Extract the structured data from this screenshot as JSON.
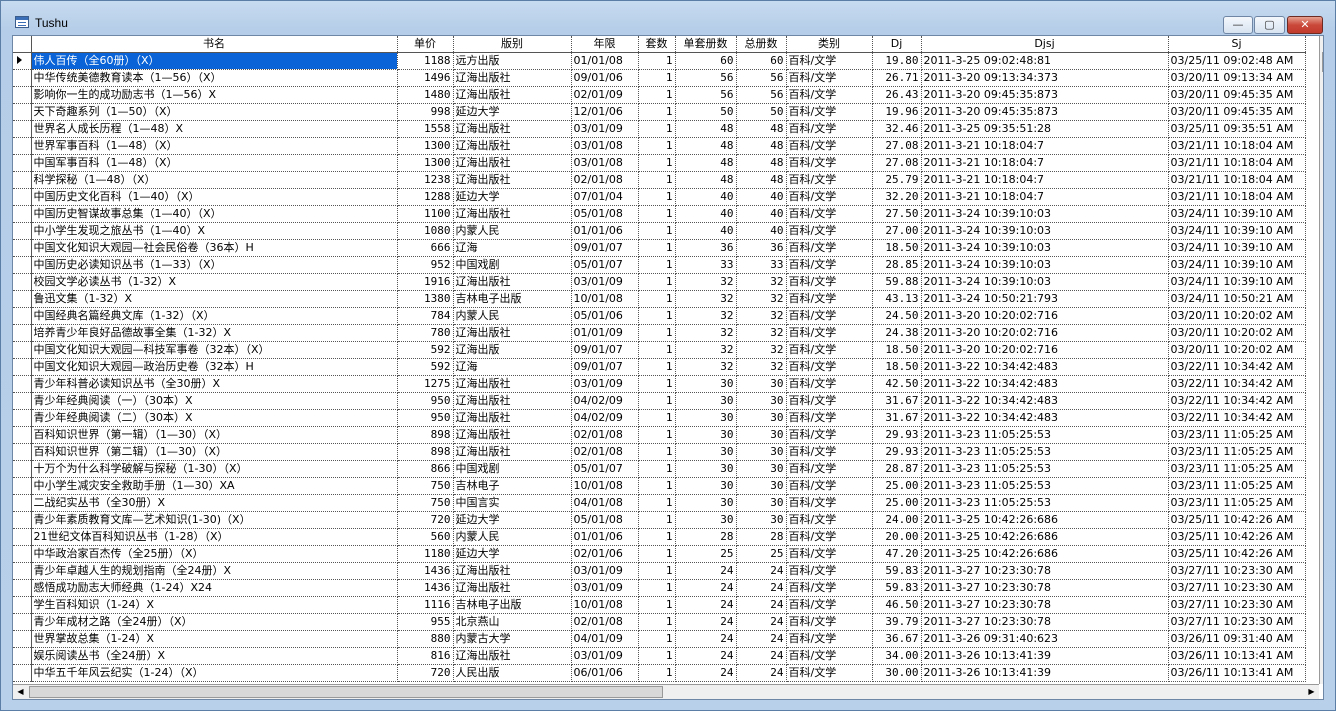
{
  "window": {
    "title": "Tushu"
  },
  "window_buttons": {
    "minimize": "—",
    "maximize": "▢",
    "close": "✕"
  },
  "columns": [
    "书名",
    "单价",
    "版别",
    "年限",
    "套数",
    "单套册数",
    "总册数",
    "类别",
    "Dj",
    "Djsj",
    "Sj"
  ],
  "rows": [
    [
      "伟人百传（全60册）（X）",
      "1188",
      "远方出版",
      "01/01/08",
      "1",
      "60",
      "60",
      "百科/文学",
      "19.80",
      "2011-3-25 09:02:48:81",
      "03/25/11 09:02:48 AM"
    ],
    [
      "中华传统美德教育读本（1—56）（X）",
      "1496",
      "辽海出版社",
      "09/01/06",
      "1",
      "56",
      "56",
      "百科/文学",
      "26.71",
      "2011-3-20 09:13:34:373",
      "03/20/11 09:13:34 AM"
    ],
    [
      "影响你一生的成功励志书（1—56）X",
      "1480",
      "辽海出版社",
      "02/01/09",
      "1",
      "56",
      "56",
      "百科/文学",
      "26.43",
      "2011-3-20 09:45:35:873",
      "03/20/11 09:45:35 AM"
    ],
    [
      "天下奇趣系列（1—50）（X）",
      "998",
      "延边大学",
      "12/01/06",
      "1",
      "50",
      "50",
      "百科/文学",
      "19.96",
      "2011-3-20 09:45:35:873",
      "03/20/11 09:45:35 AM"
    ],
    [
      "世界名人成长历程（1—48）X",
      "1558",
      "辽海出版社",
      "03/01/09",
      "1",
      "48",
      "48",
      "百科/文学",
      "32.46",
      "2011-3-25 09:35:51:28",
      "03/25/11 09:35:51 AM"
    ],
    [
      "世界军事百科（1—48）（X）",
      "1300",
      "辽海出版社",
      "03/01/08",
      "1",
      "48",
      "48",
      "百科/文学",
      "27.08",
      "2011-3-21 10:18:04:7",
      "03/21/11 10:18:04 AM"
    ],
    [
      "中国军事百科（1—48）（X）",
      "1300",
      "辽海出版社",
      "03/01/08",
      "1",
      "48",
      "48",
      "百科/文学",
      "27.08",
      "2011-3-21 10:18:04:7",
      "03/21/11 10:18:04 AM"
    ],
    [
      "科学探秘（1—48）（X）",
      "1238",
      "辽海出版社",
      "02/01/08",
      "1",
      "48",
      "48",
      "百科/文学",
      "25.79",
      "2011-3-21 10:18:04:7",
      "03/21/11 10:18:04 AM"
    ],
    [
      "中国历史文化百科（1—40）（X）",
      "1288",
      "延边大学",
      "07/01/04",
      "1",
      "40",
      "40",
      "百科/文学",
      "32.20",
      "2011-3-21 10:18:04:7",
      "03/21/11 10:18:04 AM"
    ],
    [
      "中国历史智谋故事总集（1—40）（X）",
      "1100",
      "辽海出版社",
      "05/01/08",
      "1",
      "40",
      "40",
      "百科/文学",
      "27.50",
      "2011-3-24 10:39:10:03",
      "03/24/11 10:39:10 AM"
    ],
    [
      "中小学生发现之旅丛书（1—40）X",
      "1080",
      "内蒙人民",
      "01/01/06",
      "1",
      "40",
      "40",
      "百科/文学",
      "27.00",
      "2011-3-24 10:39:10:03",
      "03/24/11 10:39:10 AM"
    ],
    [
      "中国文化知识大观园—社会民俗卷（36本）H",
      "666",
      "辽海",
      "09/01/07",
      "1",
      "36",
      "36",
      "百科/文学",
      "18.50",
      "2011-3-24 10:39:10:03",
      "03/24/11 10:39:10 AM"
    ],
    [
      "中国历史必读知识丛书（1—33）（X）",
      "952",
      "中国戏剧",
      "05/01/07",
      "1",
      "33",
      "33",
      "百科/文学",
      "28.85",
      "2011-3-24 10:39:10:03",
      "03/24/11 10:39:10 AM"
    ],
    [
      "校园文学必读丛书（1-32）X",
      "1916",
      "辽海出版社",
      "03/01/09",
      "1",
      "32",
      "32",
      "百科/文学",
      "59.88",
      "2011-3-24 10:39:10:03",
      "03/24/11 10:39:10 AM"
    ],
    [
      "鲁迅文集（1-32）X",
      "1380",
      "吉林电子出版",
      "10/01/08",
      "1",
      "32",
      "32",
      "百科/文学",
      "43.13",
      "2011-3-24 10:50:21:793",
      "03/24/11 10:50:21 AM"
    ],
    [
      "中国经典名篇经典文库（1-32）（X）",
      "784",
      "内蒙人民",
      "05/01/06",
      "1",
      "32",
      "32",
      "百科/文学",
      "24.50",
      "2011-3-20 10:20:02:716",
      "03/20/11 10:20:02 AM"
    ],
    [
      "培养青少年良好品德故事全集（1-32）X",
      "780",
      "辽海出版社",
      "01/01/09",
      "1",
      "32",
      "32",
      "百科/文学",
      "24.38",
      "2011-3-20 10:20:02:716",
      "03/20/11 10:20:02 AM"
    ],
    [
      "中国文化知识大观园—科技军事卷（32本）（X）",
      "592",
      "辽海出版",
      "09/01/07",
      "1",
      "32",
      "32",
      "百科/文学",
      "18.50",
      "2011-3-20 10:20:02:716",
      "03/20/11 10:20:02 AM"
    ],
    [
      "中国文化知识大观园—政治历史卷（32本）H",
      "592",
      "辽海",
      "09/01/07",
      "1",
      "32",
      "32",
      "百科/文学",
      "18.50",
      "2011-3-22 10:34:42:483",
      "03/22/11 10:34:42 AM"
    ],
    [
      "青少年科普必读知识丛书（全30册）X",
      "1275",
      "辽海出版社",
      "03/01/09",
      "1",
      "30",
      "30",
      "百科/文学",
      "42.50",
      "2011-3-22 10:34:42:483",
      "03/22/11 10:34:42 AM"
    ],
    [
      "青少年经典阅读（一）（30本）X",
      "950",
      "辽海出版社",
      "04/02/09",
      "1",
      "30",
      "30",
      "百科/文学",
      "31.67",
      "2011-3-22 10:34:42:483",
      "03/22/11 10:34:42 AM"
    ],
    [
      "青少年经典阅读（二）（30本）X",
      "950",
      "辽海出版社",
      "04/02/09",
      "1",
      "30",
      "30",
      "百科/文学",
      "31.67",
      "2011-3-22 10:34:42:483",
      "03/22/11 10:34:42 AM"
    ],
    [
      "百科知识世界（第一辑）（1—30）（X）",
      "898",
      "辽海出版社",
      "02/01/08",
      "1",
      "30",
      "30",
      "百科/文学",
      "29.93",
      "2011-3-23 11:05:25:53",
      "03/23/11 11:05:25 AM"
    ],
    [
      "百科知识世界（第二辑）（1—30）（X）",
      "898",
      "辽海出版社",
      "02/01/08",
      "1",
      "30",
      "30",
      "百科/文学",
      "29.93",
      "2011-3-23 11:05:25:53",
      "03/23/11 11:05:25 AM"
    ],
    [
      "十万个为什么科学破解与探秘（1-30）（X）",
      "866",
      "中国戏剧",
      "05/01/07",
      "1",
      "30",
      "30",
      "百科/文学",
      "28.87",
      "2011-3-23 11:05:25:53",
      "03/23/11 11:05:25 AM"
    ],
    [
      "中小学生减灾安全救助手册（1—30）XA",
      "750",
      "吉林电子",
      "10/01/08",
      "1",
      "30",
      "30",
      "百科/文学",
      "25.00",
      "2011-3-23 11:05:25:53",
      "03/23/11 11:05:25 AM"
    ],
    [
      "二战纪实丛书（全30册）X",
      "750",
      "中国言实",
      "04/01/08",
      "1",
      "30",
      "30",
      "百科/文学",
      "25.00",
      "2011-3-23 11:05:25:53",
      "03/23/11 11:05:25 AM"
    ],
    [
      "青少年素质教育文库—艺术知识(1-30)（X）",
      "720",
      "延边大学",
      "05/01/08",
      "1",
      "30",
      "30",
      "百科/文学",
      "24.00",
      "2011-3-25 10:42:26:686",
      "03/25/11 10:42:26 AM"
    ],
    [
      "21世纪文体百科知识丛书（1-28）（X）",
      "560",
      "内蒙人民",
      "01/01/06",
      "1",
      "28",
      "28",
      "百科/文学",
      "20.00",
      "2011-3-25 10:42:26:686",
      "03/25/11 10:42:26 AM"
    ],
    [
      "中华政治家百杰传（全25册）（X）",
      "1180",
      "延边大学",
      "02/01/06",
      "1",
      "25",
      "25",
      "百科/文学",
      "47.20",
      "2011-3-25 10:42:26:686",
      "03/25/11 10:42:26 AM"
    ],
    [
      "青少年卓越人生的规划指南（全24册）X",
      "1436",
      "辽海出版社",
      "03/01/09",
      "1",
      "24",
      "24",
      "百科/文学",
      "59.83",
      "2011-3-27 10:23:30:78",
      "03/27/11 10:23:30 AM"
    ],
    [
      "感悟成功励志大师经典（1-24）X24",
      "1436",
      "辽海出版社",
      "03/01/09",
      "1",
      "24",
      "24",
      "百科/文学",
      "59.83",
      "2011-3-27 10:23:30:78",
      "03/27/11 10:23:30 AM"
    ],
    [
      "学生百科知识（1-24）X",
      "1116",
      "吉林电子出版",
      "10/01/08",
      "1",
      "24",
      "24",
      "百科/文学",
      "46.50",
      "2011-3-27 10:23:30:78",
      "03/27/11 10:23:30 AM"
    ],
    [
      "青少年成材之路（全24册）（X）",
      "955",
      "北京燕山",
      "02/01/08",
      "1",
      "24",
      "24",
      "百科/文学",
      "39.79",
      "2011-3-27 10:23:30:78",
      "03/27/11 10:23:30 AM"
    ],
    [
      "世界掌故总集（1-24）X",
      "880",
      "内蒙古大学",
      "04/01/09",
      "1",
      "24",
      "24",
      "百科/文学",
      "36.67",
      "2011-3-26 09:31:40:623",
      "03/26/11 09:31:40 AM"
    ],
    [
      "娱乐阅读丛书（全24册）X",
      "816",
      "辽海出版社",
      "03/01/09",
      "1",
      "24",
      "24",
      "百科/文学",
      "34.00",
      "2011-3-26 10:13:41:39",
      "03/26/11 10:13:41 AM"
    ],
    [
      "中华五千年风云纪实（1-24）（X）",
      "720",
      "人民出版",
      "06/01/06",
      "1",
      "24",
      "24",
      "百科/文学",
      "30.00",
      "2011-3-26 10:13:41:39",
      "03/26/11 10:13:41 AM"
    ]
  ],
  "icons": {
    "app": "table-icon",
    "current_row": "row-pointer-icon"
  }
}
